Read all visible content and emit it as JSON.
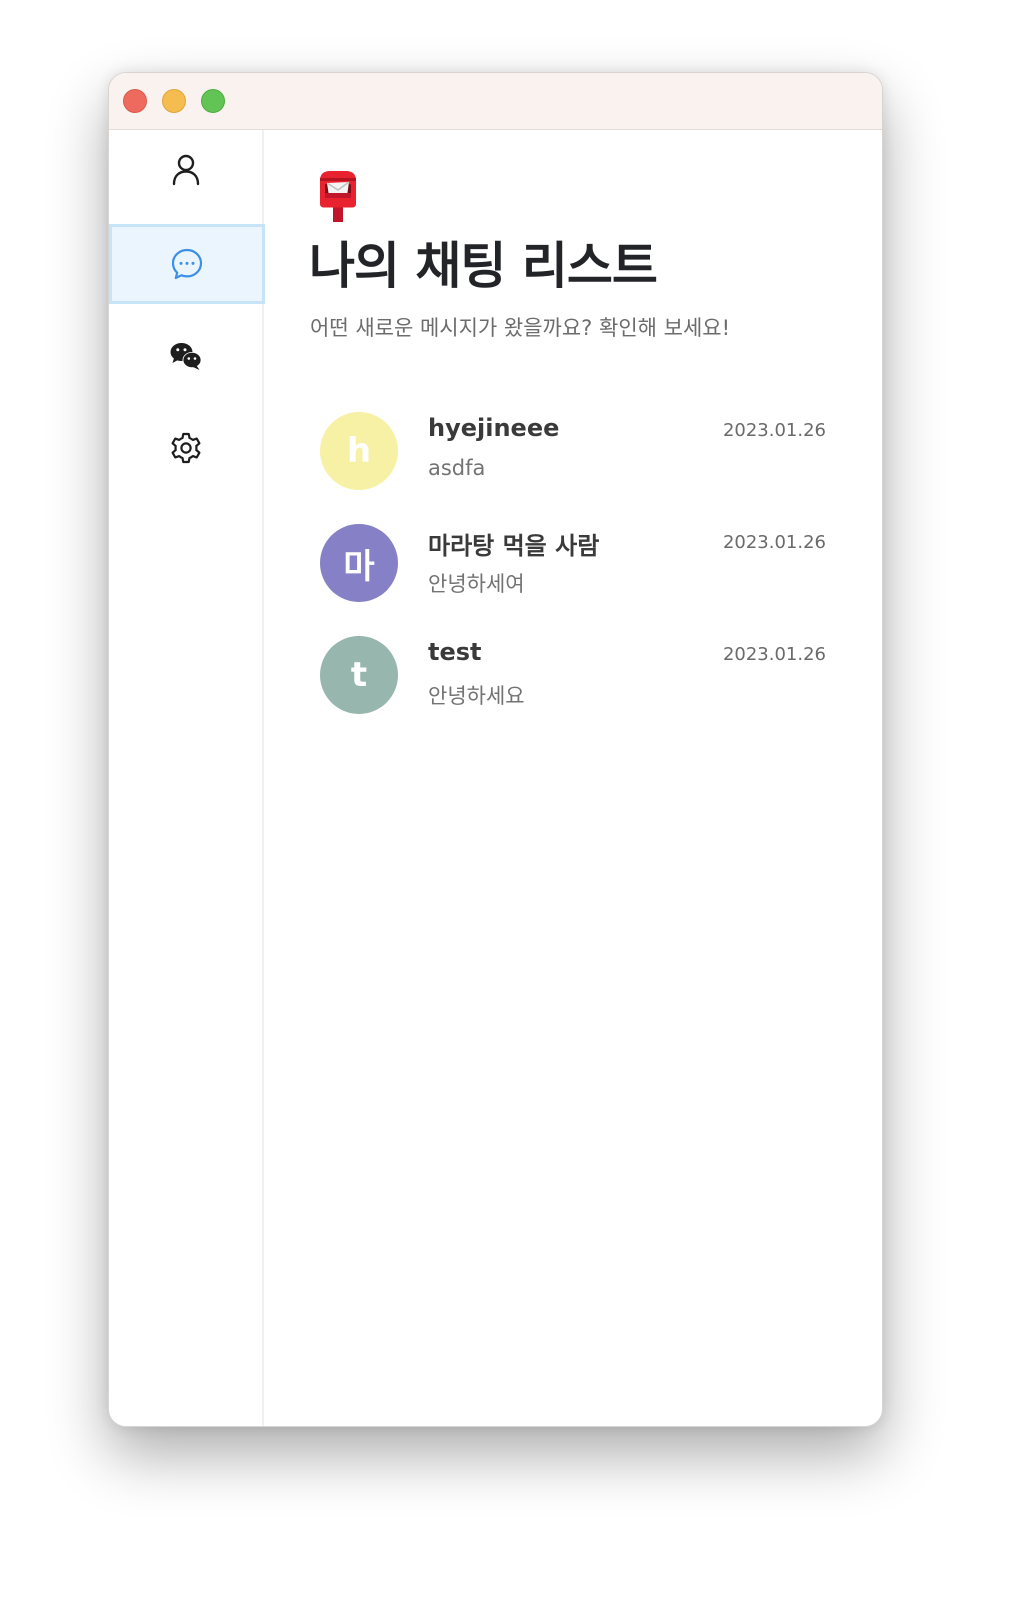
{
  "window": {
    "controls": [
      "close",
      "minimize",
      "maximize"
    ]
  },
  "sidebar": {
    "items": [
      {
        "name": "friends",
        "icon": "person-icon",
        "active": false
      },
      {
        "name": "chats",
        "icon": "chat-bubble-icon",
        "active": true
      },
      {
        "name": "open-chat",
        "icon": "wechat-icon",
        "active": false
      },
      {
        "name": "settings",
        "icon": "gear-icon",
        "active": false
      }
    ]
  },
  "header": {
    "emoji_icon": "postbox-icon",
    "title": "나의 채팅 리스트",
    "subtitle": "어떤 새로운 메시지가 왔을까요? 확인해 보세요!"
  },
  "chats": [
    {
      "initial": "h",
      "name": "hyejineee",
      "message": "asdfa",
      "date": "2023.01.26",
      "avatar_color": "#f6f1a4"
    },
    {
      "initial": "마",
      "name": "마라탕 먹을 사람",
      "message": "안녕하세여",
      "date": "2023.01.26",
      "avatar_color": "#8680c6"
    },
    {
      "initial": "t",
      "name": "test",
      "message": "안녕하세요",
      "date": "2023.01.26",
      "avatar_color": "#96b6ae"
    }
  ],
  "colors": {
    "accent": "#3d8fe8",
    "active_bg": "#eaf5fe",
    "titlebar_bg": "#faf2ee"
  }
}
